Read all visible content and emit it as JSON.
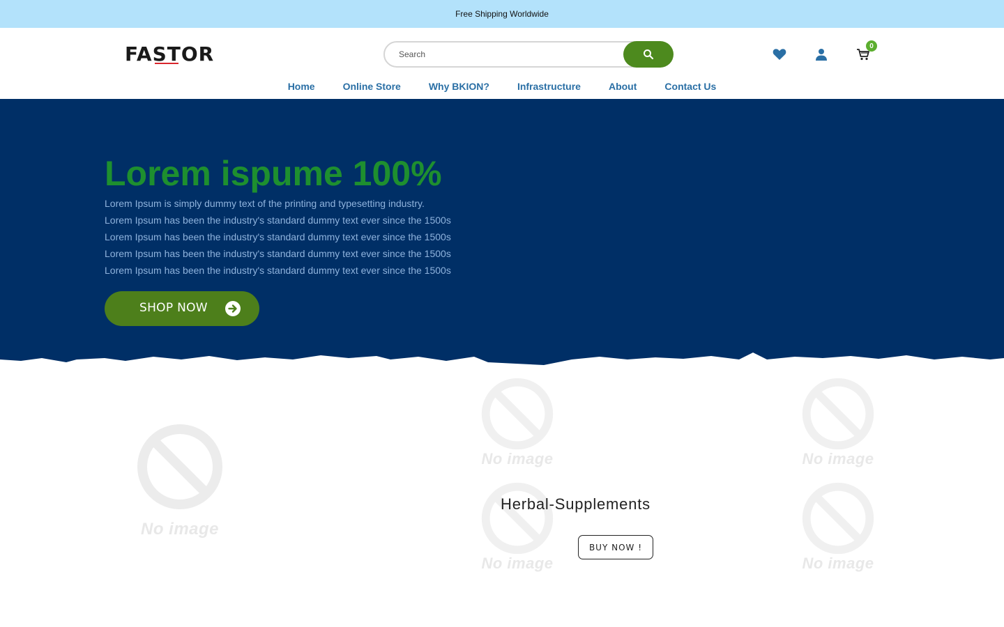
{
  "topbar": {
    "text": "Free Shipping Worldwide"
  },
  "header": {
    "logo": "FASTOR",
    "search": {
      "placeholder": "Search"
    },
    "icons": [
      "heart-icon",
      "user-icon",
      "cart-icon",
      "search-icon"
    ],
    "cart_count": "0"
  },
  "nav": {
    "items": [
      {
        "label": "Home"
      },
      {
        "label": "Online Store"
      },
      {
        "label": "Why BKION?"
      },
      {
        "label": "Infrastructure"
      },
      {
        "label": "About"
      },
      {
        "label": "Contact Us"
      }
    ]
  },
  "hero": {
    "title": "Lorem ispume 100%",
    "lines": [
      "Lorem Ipsum is simply dummy text of the printing and typesetting industry.",
      "Lorem Ipsum has been the industry's standard dummy text ever since the 1500s",
      "Lorem Ipsum has been the industry's standard dummy text ever since the 1500s",
      "Lorem Ipsum has been the industry's standard dummy text ever since the 1500s",
      "Lorem Ipsum has been the industry's standard dummy text ever since the 1500s"
    ],
    "cta": "SHOP NOW"
  },
  "products": {
    "no_image_text": "No image",
    "title": "Herbal-Supplements",
    "buy_label": "BUY NOW !"
  },
  "colors": {
    "topbar": "#b3e2fb",
    "hero_bg": "#002f66",
    "accent_green": "#4d8a1e",
    "title_green": "#1e8f2f",
    "nav_blue": "#2a6fa5"
  }
}
